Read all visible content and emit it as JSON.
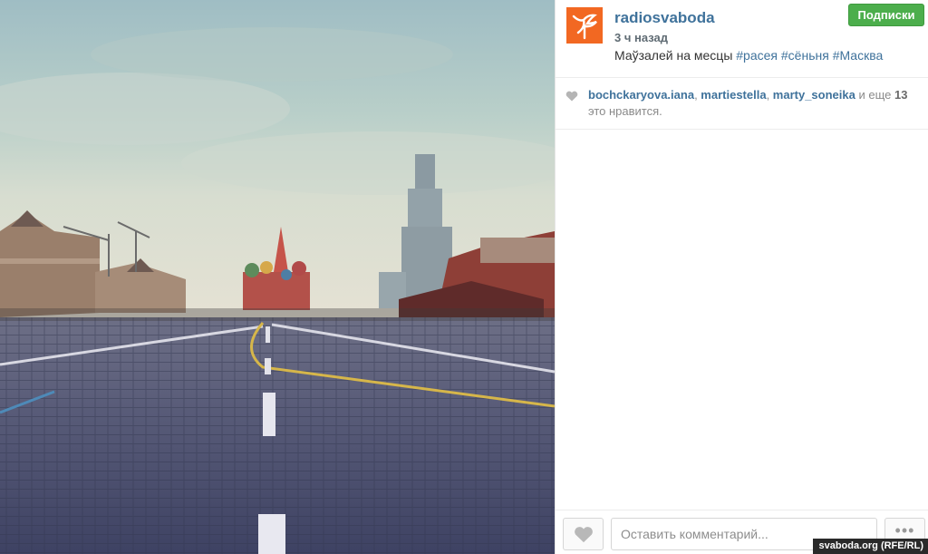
{
  "post": {
    "username": "radiosvaboda",
    "time_ago": "3 ч назад",
    "caption_text": "Маўзалей на месцы ",
    "hashtags": [
      "#расея",
      "#сёньня",
      "#Масква"
    ],
    "follow_label": "Подписки"
  },
  "likes": {
    "users": [
      "bochckaryova.iana",
      "martiestella",
      "marty_soneika"
    ],
    "and_more": "и еще",
    "more_count": "13",
    "suffix": "это нравится."
  },
  "footer": {
    "comment_placeholder": "Оставить комментарий...",
    "more_label": "•••"
  },
  "watermark": "svaboda.org (RFE/RL)",
  "colors": {
    "brand_orange": "#f26822",
    "link_blue": "#3f729b",
    "follow_green": "#4cae4c"
  },
  "icons": [
    "radio-svoboda-logo-icon",
    "heart-icon",
    "more-icon"
  ]
}
